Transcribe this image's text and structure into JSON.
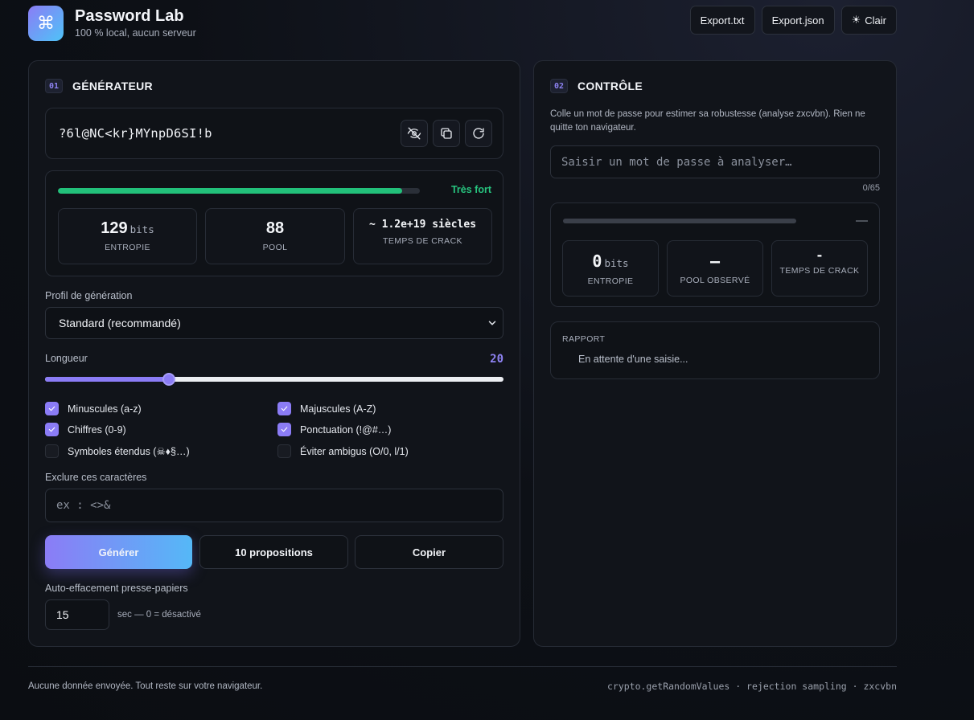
{
  "brand": {
    "title": "Password Lab",
    "subtitle": "100 % local, aucun serveur",
    "logo_glyph": "⌘"
  },
  "header_buttons": {
    "export_txt": "Export.txt",
    "export_json": "Export.json",
    "theme_glyph": "☀",
    "theme_label": "Clair"
  },
  "generator": {
    "step": "01",
    "title": "GÉNÉRATEUR",
    "password": "?6l@NC<kr}MYnpD6SI!b",
    "strength_label": "Très fort",
    "strength_fill": 0.95,
    "stats": {
      "entropy_value": "129",
      "entropy_unit": "bits",
      "entropy_label": "ENTROPIE",
      "pool_value": "88",
      "pool_label": "POOL",
      "crack_value": "~ 1.2e+19 siècles",
      "crack_label": "TEMPS DE CRACK"
    },
    "profile_label": "Profil de génération",
    "profile_value": "Standard (recommandé)",
    "length_label": "Longueur",
    "length_value": "20",
    "length_fraction": 0.27,
    "options": [
      {
        "label": "Minuscules (a-z)",
        "checked": true
      },
      {
        "label": "Majuscules (A-Z)",
        "checked": true
      },
      {
        "label": "Chiffres (0-9)",
        "checked": true
      },
      {
        "label": "Ponctuation (!@#…)",
        "checked": true
      },
      {
        "label": "Symboles étendus (☠♦§…)",
        "checked": false
      },
      {
        "label": "Éviter ambigus (O/0, l/1)",
        "checked": false
      }
    ],
    "exclude_label": "Exclure ces caractères",
    "exclude_placeholder": "ex : <>&",
    "btn_generate": "Générer",
    "btn_proposals": "10 propositions",
    "btn_copy": "Copier",
    "clear_label": "Auto-effacement presse-papiers",
    "clear_value": "15",
    "clear_hint": "sec — 0 = désactivé"
  },
  "control": {
    "step": "02",
    "title": "CONTRÔLE",
    "description": "Colle un mot de passe pour estimer sa robustesse (analyse zxcvbn). Rien ne quitte ton navigateur.",
    "input_placeholder": "Saisir un mot de passe à analyser…",
    "counter": "0/65",
    "dash": "—",
    "stats": {
      "entropy_value": "0",
      "entropy_unit": "bits",
      "entropy_label": "ENTROPIE",
      "pool_value": "–",
      "pool_label": "POOL OBSERVÉ",
      "crack_value": "-",
      "crack_label": "TEMPS DE CRACK"
    },
    "report_title": "RAPPORT",
    "report_text": "En attente d'une saisie..."
  },
  "footer": {
    "left": "Aucune donnée envoyée. Tout reste sur votre navigateur.",
    "right": "crypto.getRandomValues · rejection sampling · zxcvbn"
  },
  "colors": {
    "accent": "#8b7cf6",
    "accent2": "#4ec3f7",
    "strong": "#22c07a"
  }
}
